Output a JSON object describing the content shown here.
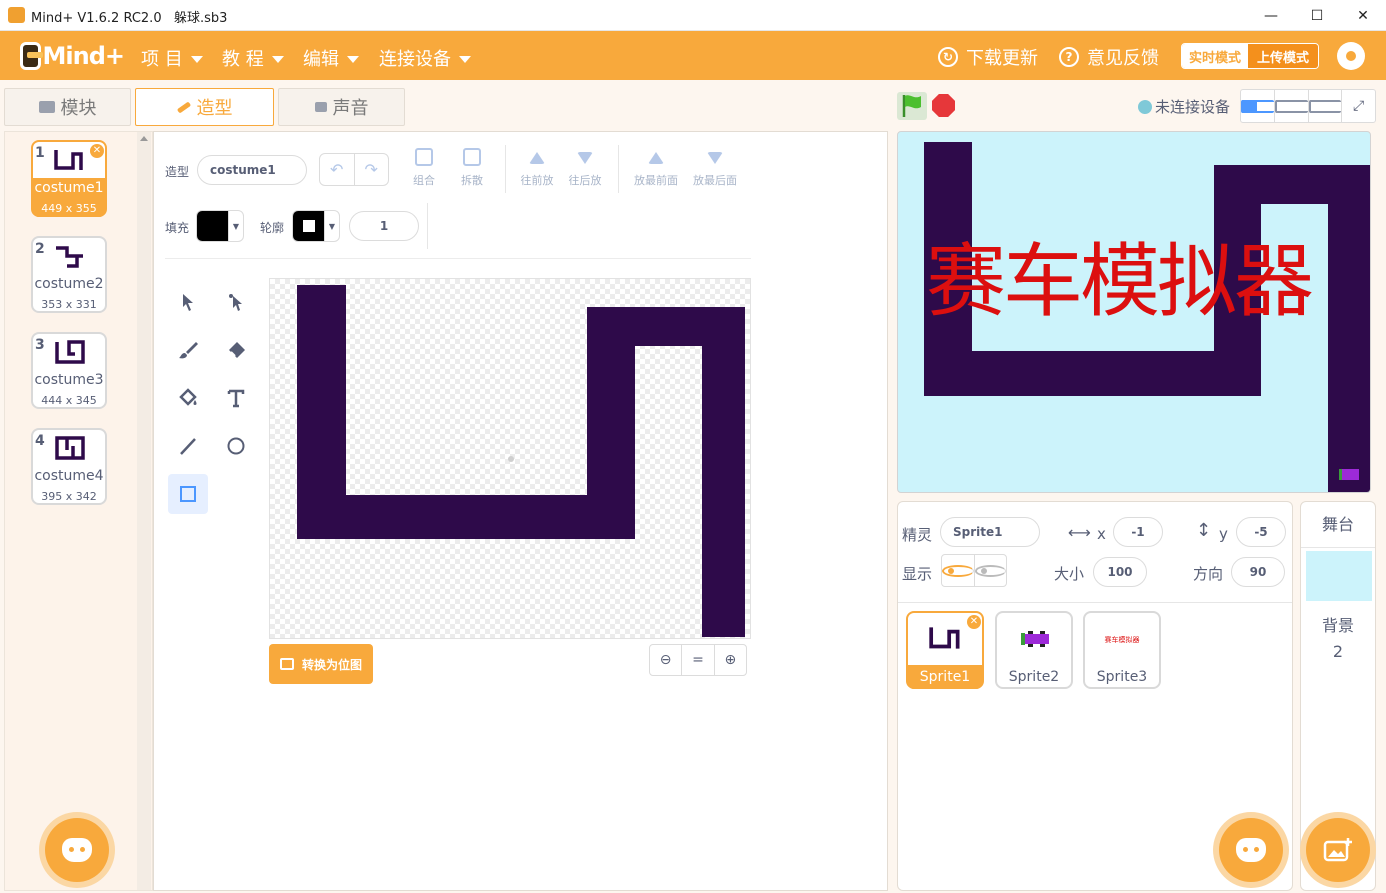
{
  "window": {
    "title": "Mind+ V1.6.2 RC2.0   躲球.sb3",
    "minimize": "—",
    "maximize": "☐",
    "close": "✕"
  },
  "menubar": {
    "logo_text": "Mind+",
    "items": [
      {
        "label": "项 目"
      },
      {
        "label": "教 程"
      },
      {
        "label": "编辑"
      },
      {
        "label": "连接设备"
      }
    ],
    "download_update": "下载更新",
    "feedback": "意见反馈",
    "mode_realtime": "实时模式",
    "mode_upload": "上传模式",
    "accent_color": "#f8a93c"
  },
  "tabs": [
    {
      "label": "模块",
      "icon": "blocks-icon"
    },
    {
      "label": "造型",
      "icon": "brush-icon",
      "active": true
    },
    {
      "label": "声音",
      "icon": "speaker-icon"
    }
  ],
  "costumes": [
    {
      "num": "1",
      "name": "costume1",
      "size": "449 x 355",
      "selected": true
    },
    {
      "num": "2",
      "name": "costume2",
      "size": "353 x 331"
    },
    {
      "num": "3",
      "name": "costume3",
      "size": "444 x 345"
    },
    {
      "num": "4",
      "name": "costume4",
      "size": "395 x 342"
    }
  ],
  "editor": {
    "costume_label": "造型",
    "costume_name": "costume1",
    "fill_label": "填充",
    "outline_label": "轮廓",
    "outline_width": "1",
    "group": "组合",
    "ungroup": "拆散",
    "forward": "往前放",
    "backward": "往后放",
    "front": "放最前面",
    "back": "放最后面",
    "convert_bitmap": "转换为位图",
    "zoom_reset": "="
  },
  "stage": {
    "connection_status": "未连接设备",
    "title_text": "赛车模拟器",
    "track_color": "#2e0a4a",
    "background_color": "#ccf3fb"
  },
  "sprite_info": {
    "sprite_label": "精灵",
    "sprite_name": "Sprite1",
    "x_label": "x",
    "x_value": "-1",
    "y_label": "y",
    "y_value": "-5",
    "show_label": "显示",
    "size_label": "大小",
    "size_value": "100",
    "direction_label": "方向",
    "direction_value": "90"
  },
  "sprites": [
    {
      "name": "Sprite1",
      "selected": true
    },
    {
      "name": "Sprite2"
    },
    {
      "name": "Sprite3",
      "thumb_text": "赛车模拟器"
    }
  ],
  "stage_panel": {
    "header": "舞台",
    "backdrop_label": "背景",
    "backdrop_count": "2"
  }
}
